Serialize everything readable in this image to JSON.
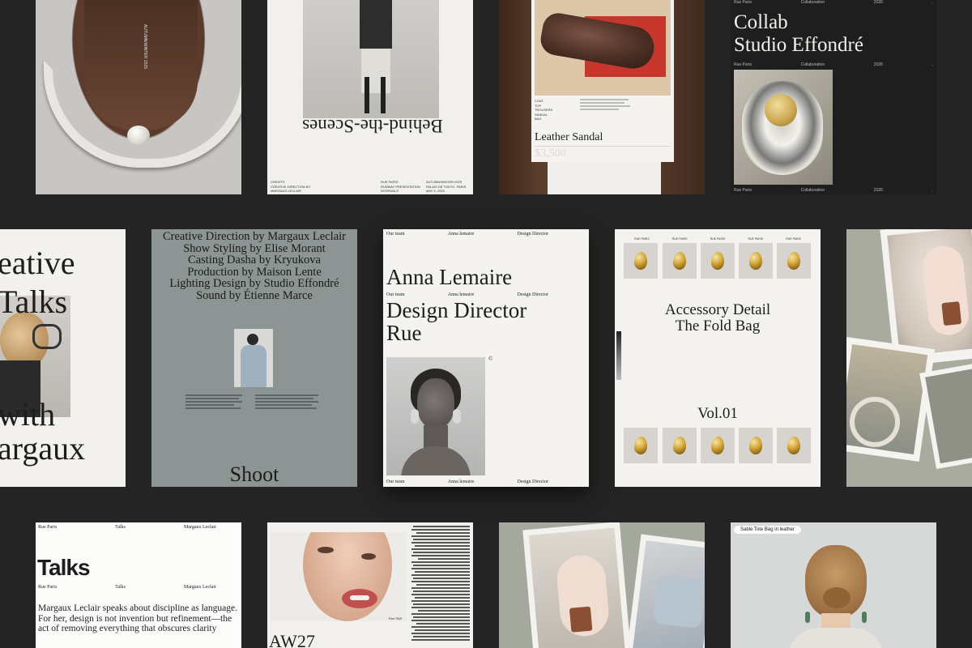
{
  "row1": {
    "scenes": {
      "headline": "Behind-the-Scenes",
      "left_meta": "CREDITS\nCREATIVE DIRECTION BY MARGAUX LECLAIR\nSHOW STYLING BY ELISE MORANT\nCASTING BY DASHA KRYUKOVA",
      "center_meta": "RUE PARIS\nRUNWAY PRESENTATION\nINTERVALS",
      "right_meta": "AUTUMN/WINTER 2025\nPALAIS DE TOKYO, PARIS\nMAY 9, 2025"
    },
    "sandal": {
      "title": "Leather Sandal",
      "price": "$3,500",
      "specs": "COAT\nTOP\nTROUSERS\nSANDAL\nBAG"
    },
    "collab": {
      "title_line1": "Collab",
      "title_line2": "Studio Effondré",
      "meta": [
        "Rue Paris",
        "Collaboration",
        "2026"
      ]
    }
  },
  "row2": {
    "talks": {
      "lines": [
        "eative",
        "Talks",
        "with",
        "argaux"
      ]
    },
    "shoot": {
      "credits": [
        "Creative Direction by Margaux Leclair",
        "Show Styling by Elise Morant",
        "Casting Dasha by Kryukova",
        "Production by Maison Lente",
        "Lighting Design by Studio Effondré",
        "Sound by Étienne Marce"
      ],
      "title": "Shoot"
    },
    "team": {
      "top": [
        "Our team",
        "Anna lemaire",
        "Design Director"
      ],
      "name": "Anna Lemaire",
      "mid": [
        "Our team",
        "Anna lemaire",
        "Design Director"
      ],
      "role_line1": "Design Director",
      "role_line2": "Rue",
      "copyright": "©",
      "bottom": [
        "Our team",
        "Anna lemaire",
        "Design Director"
      ]
    },
    "accessory": {
      "label": "RUE PARIS",
      "title_line1": "Accessory Detail",
      "title_line2": "The Fold Bag",
      "volume": "Vol.01"
    }
  },
  "row3": {
    "talks2": {
      "meta_top": [
        "Rue Paris",
        "Talks",
        "Margaux Leclair"
      ],
      "title": "Talks",
      "meta_mid": [
        "Rue Paris",
        "Talks",
        "Margaux Leclair"
      ],
      "quote": "Margaux Leclair speaks about discipline as language. For her, design is not invention but refinement—the act of removing everything that obscures clarity"
    },
    "aw": {
      "label": "AW27",
      "tag": "Rue PAR"
    },
    "bag": {
      "label": "Sable Tote Bag in leather"
    }
  },
  "colors": {
    "background": "#242424",
    "paper": "#f3f1ec",
    "slate": "#8d9494",
    "gold": "#d2a53c"
  }
}
